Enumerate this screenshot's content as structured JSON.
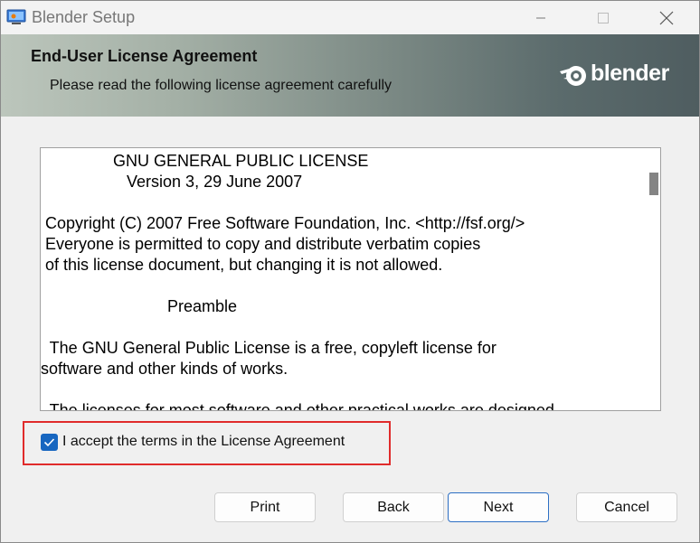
{
  "window": {
    "title": "Blender Setup"
  },
  "banner": {
    "title": "End-User License Agreement",
    "subtitle": "Please read the following license agreement carefully",
    "logo_text": "blender"
  },
  "license": {
    "lines": [
      "                GNU GENERAL PUBLIC LICENSE",
      "                   Version 3, 29 June 2007",
      "",
      " Copyright (C) 2007 Free Software Foundation, Inc. <http://fsf.org/>",
      " Everyone is permitted to copy and distribute verbatim copies",
      " of this license document, but changing it is not allowed.",
      "",
      "                            Preamble",
      "",
      "  The GNU General Public License is a free, copyleft license for",
      "software and other kinds of works.",
      "",
      "  The licenses for most software and other practical works are designed"
    ]
  },
  "accept": {
    "label": "I accept the terms in the License Agreement",
    "checked": true
  },
  "buttons": {
    "print": "Print",
    "back": "Back",
    "next": "Next",
    "cancel": "Cancel"
  },
  "colors": {
    "accent": "#1766c0",
    "highlight_border": "#e02b2b"
  }
}
